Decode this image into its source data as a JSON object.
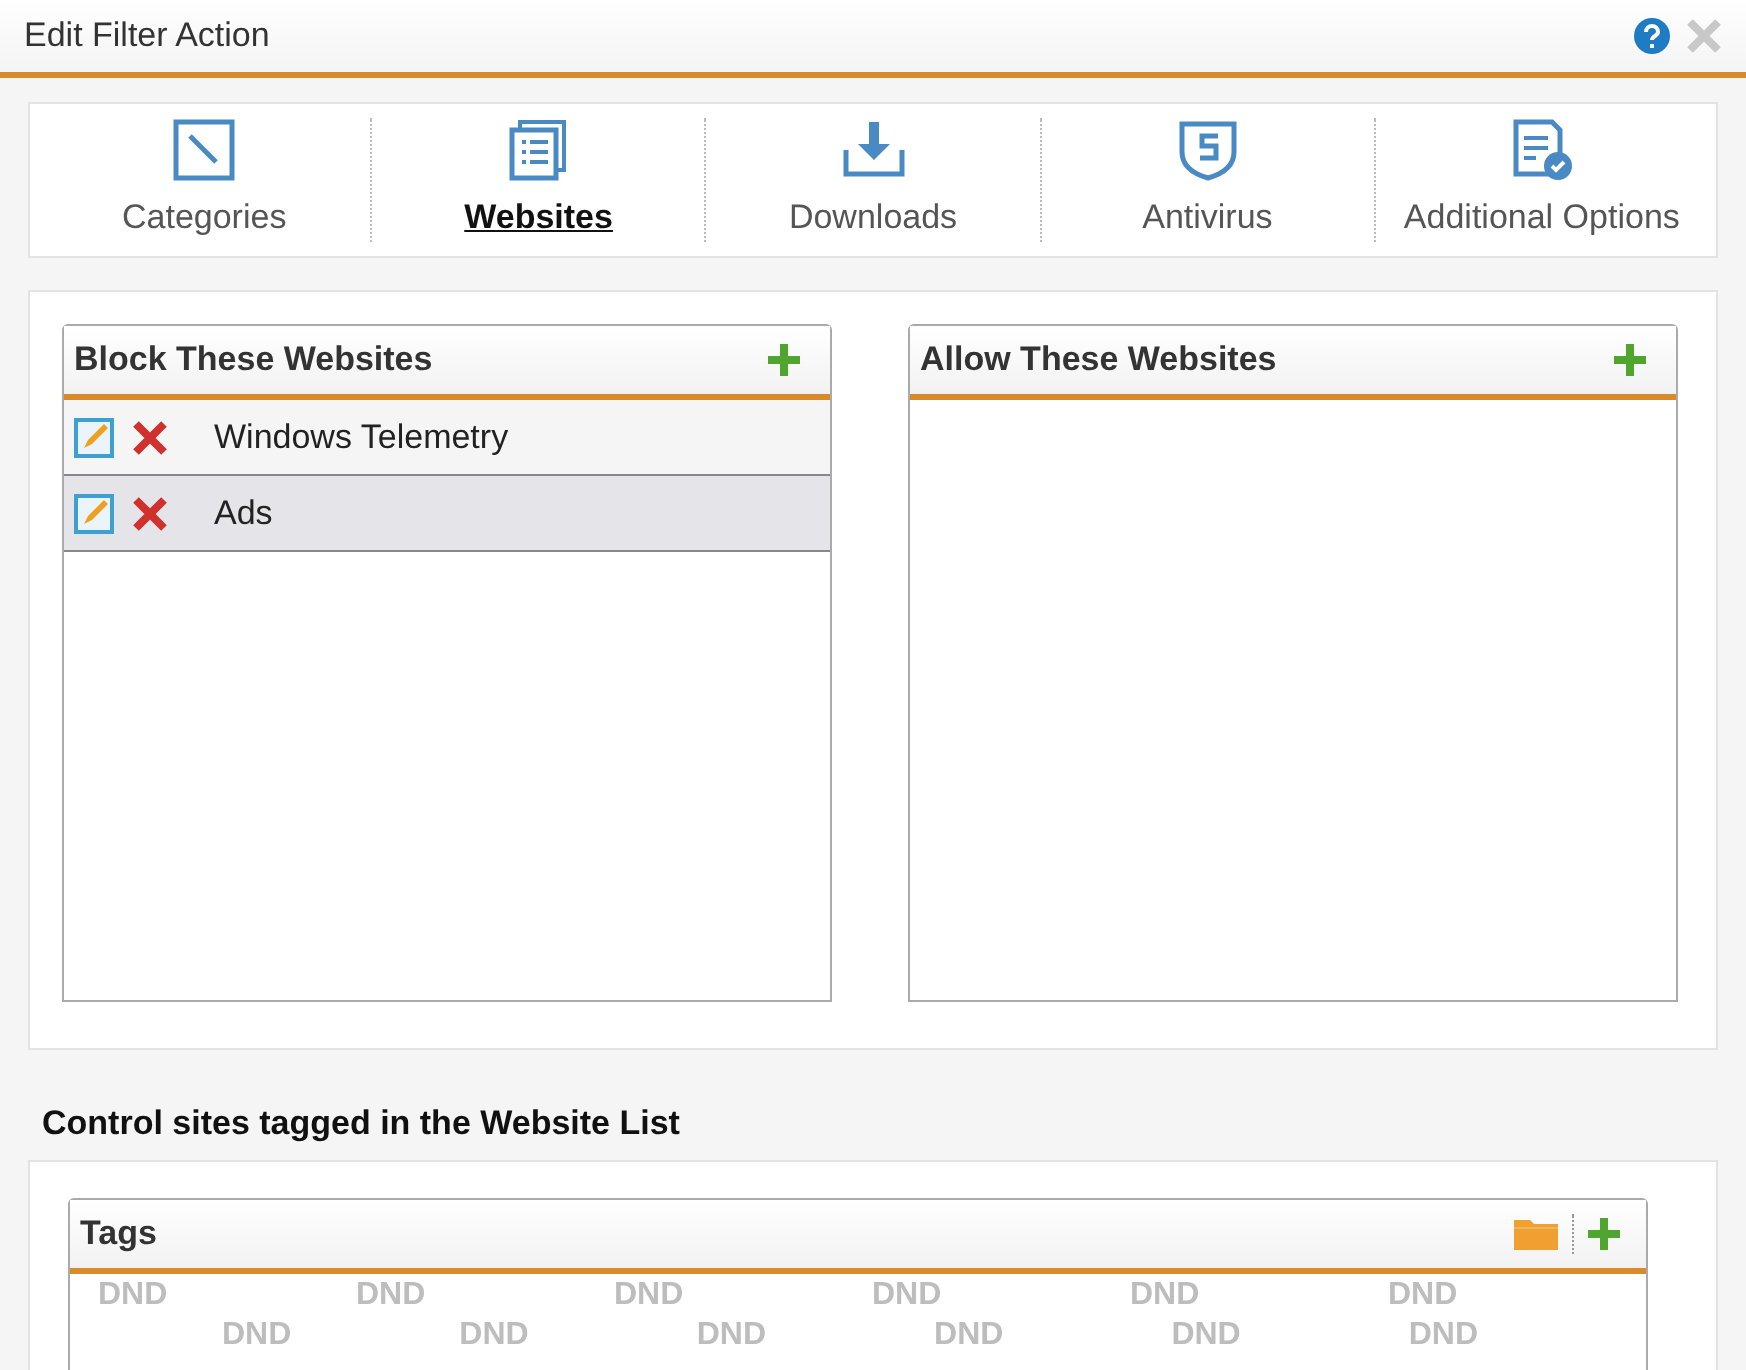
{
  "window": {
    "title": "Edit Filter Action"
  },
  "tabs": [
    {
      "label": "Categories",
      "selected": false
    },
    {
      "label": "Websites",
      "selected": true
    },
    {
      "label": "Downloads",
      "selected": false
    },
    {
      "label": "Antivirus",
      "selected": false
    },
    {
      "label": "Additional Options",
      "selected": false
    }
  ],
  "lists": [
    {
      "title": "Block These Websites",
      "items": [
        {
          "name": "Windows Telemetry",
          "selected": false
        },
        {
          "name": "Ads",
          "selected": true
        }
      ]
    },
    {
      "title": "Allow These Websites"
    }
  ],
  "tags_section": {
    "heading": "Control sites tagged in the Website List",
    "panel_title": "Tags",
    "drop_hints": [
      [
        "DND",
        "DND",
        "DND",
        "DND",
        "DND",
        "DND"
      ],
      [
        "DND",
        "DND",
        "DND",
        "DND",
        "DND",
        "DND"
      ]
    ]
  }
}
